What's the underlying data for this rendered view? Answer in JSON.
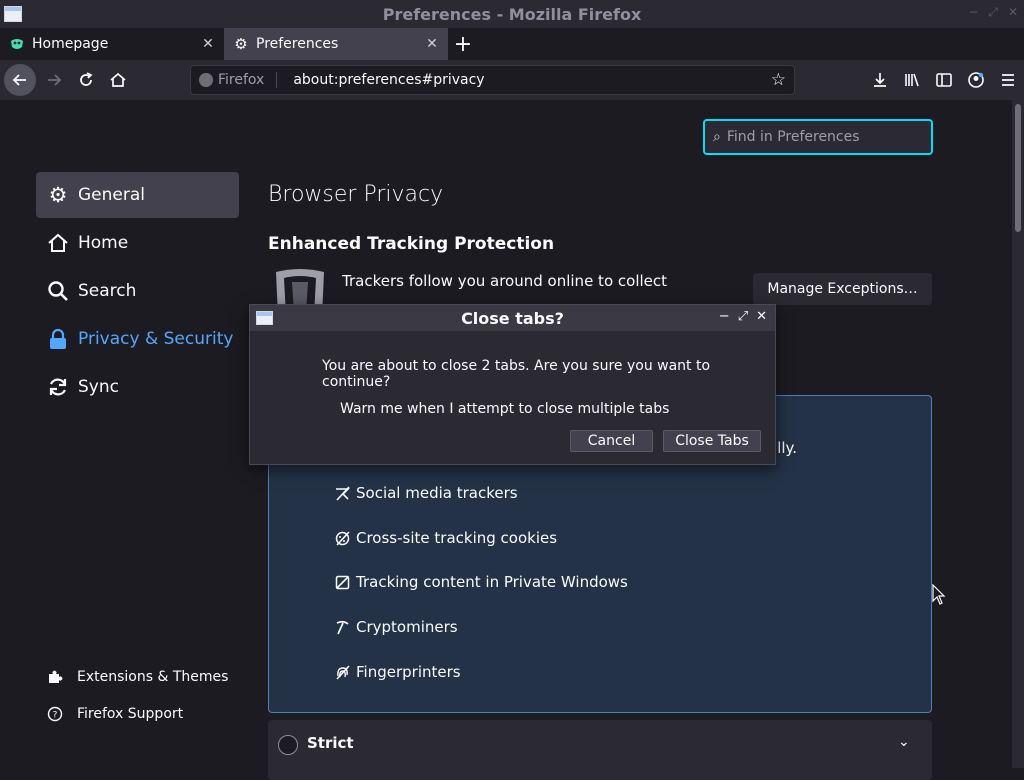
{
  "window": {
    "title": "Preferences - Mozilla Firefox",
    "controls": [
      "−",
      "⤢",
      "✕"
    ]
  },
  "tabs": [
    {
      "label": "Homepage",
      "icon": "mask-icon",
      "active": false
    },
    {
      "label": "Preferences",
      "icon": "gear-icon",
      "active": true
    }
  ],
  "newtab_label": "+",
  "navbar": {
    "identity_label": "Firefox",
    "url": "about:preferences#privacy"
  },
  "find": {
    "placeholder": "Find in Preferences"
  },
  "sidebar": {
    "items": [
      {
        "label": "General",
        "icon": "gear-icon",
        "selected": true
      },
      {
        "label": "Home",
        "icon": "home-icon",
        "selected": false
      },
      {
        "label": "Search",
        "icon": "search-icon",
        "selected": false
      },
      {
        "label": "Privacy & Security",
        "icon": "lock-icon",
        "selected": false
      },
      {
        "label": "Sync",
        "icon": "sync-icon",
        "selected": false
      }
    ],
    "footer": [
      {
        "label": "Extensions & Themes",
        "icon": "puzzle-icon"
      },
      {
        "label": "Firefox Support",
        "icon": "help-icon"
      }
    ]
  },
  "main": {
    "page_title": "Browser Privacy",
    "section_title": "Enhanced Tracking Protection",
    "etp_description": "Trackers follow you around online to collect",
    "manage_exceptions_label": "Manage Exceptions…",
    "standard_partial_text": "ally.",
    "blocked_items": [
      {
        "label": "Social media trackers",
        "icon": "social-tracker-icon"
      },
      {
        "label": "Cross-site tracking cookies",
        "icon": "cookie-icon"
      },
      {
        "label": "Tracking content in Private Windows",
        "icon": "tracking-content-icon"
      },
      {
        "label": "Cryptominers",
        "icon": "cryptominer-icon"
      },
      {
        "label": "Fingerprinters",
        "icon": "fingerprint-icon"
      }
    ],
    "strict_label": "Strict"
  },
  "dialog": {
    "title": "Close tabs?",
    "message": "You are about to close 2 tabs. Are you sure you want to continue?",
    "warn_text": "Warn me when I attempt to close multiple tabs",
    "cancel_label": "Cancel",
    "confirm_label": "Close Tabs",
    "controls": [
      "−",
      "⤢",
      "✕"
    ]
  }
}
